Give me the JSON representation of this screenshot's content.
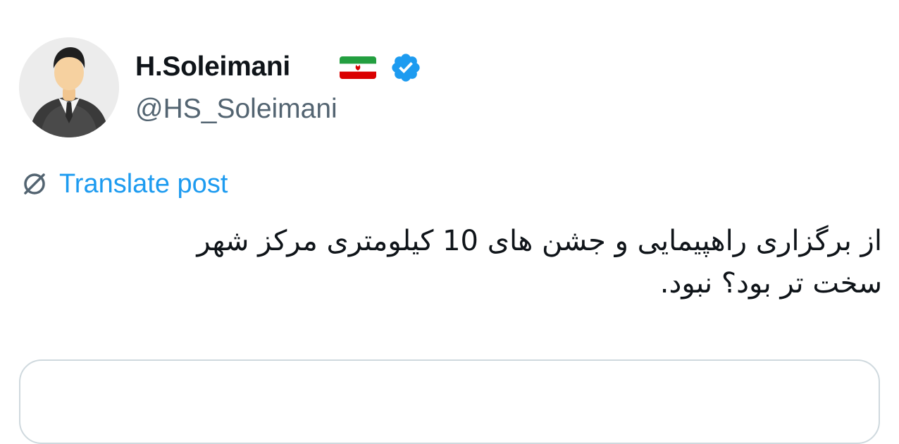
{
  "author": {
    "display_name": "H.Soleimani",
    "handle": "@HS_Soleimani",
    "avatar_icon": "businessman-avatar-icon",
    "flag_icon": "iran-flag-icon",
    "verified_icon": "verified-badge-icon"
  },
  "translate": {
    "label": "Translate post",
    "icon": "globe-slash-icon"
  },
  "post": {
    "lines": [
      "از برگزاری راهپیمایی و جشن های 10 کیلومتری مرکز شهر",
      "سخت تر بود؟ نبود."
    ]
  },
  "colors": {
    "text": "#0f1419",
    "secondary_text": "#536471",
    "link": "#1d9bf0",
    "verified": "#1d9bf0",
    "border": "#cfd9de"
  }
}
